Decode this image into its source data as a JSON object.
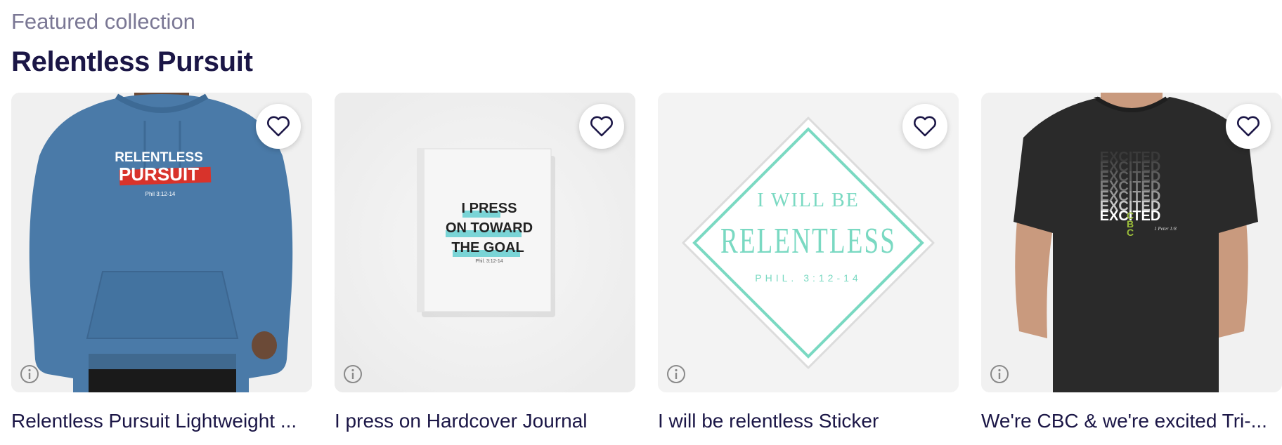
{
  "section": {
    "eyebrow": "Featured collection",
    "title": "Relentless Pursuit"
  },
  "colors": {
    "title": "#1b1646",
    "eyebrow": "#7a7794",
    "hoodie": "#4a7aa8",
    "teal": "#7ad9c2",
    "shirt": "#2a2a2a"
  },
  "products": [
    {
      "name": "Relentless Pursuit Lightweight ...",
      "art": {
        "line1": "RELENTLESS",
        "line2": "PURSUIT",
        "ref": "Phil 3:12-14"
      },
      "favorite_icon": "heart-outline-icon",
      "info_icon": "info-icon"
    },
    {
      "name": "I press on Hardcover Journal",
      "art": {
        "line1": "I PRESS",
        "line2": "ON TOWARD",
        "line3": "THE GOAL",
        "ref": "Phil. 3:12-14"
      },
      "favorite_icon": "heart-outline-icon",
      "info_icon": "info-icon"
    },
    {
      "name": "I will be relentless Sticker",
      "art": {
        "line1": "I WILL BE",
        "line2": "RELENTLESS",
        "ref": "PHIL. 3:12-14"
      },
      "favorite_icon": "heart-outline-icon",
      "info_icon": "info-icon"
    },
    {
      "name": "We're CBC & we're excited Tri-...",
      "art": {
        "word": "EXCITED",
        "ref": "1 Peter 1:8"
      },
      "favorite_icon": "heart-outline-icon",
      "info_icon": "info-icon"
    }
  ]
}
